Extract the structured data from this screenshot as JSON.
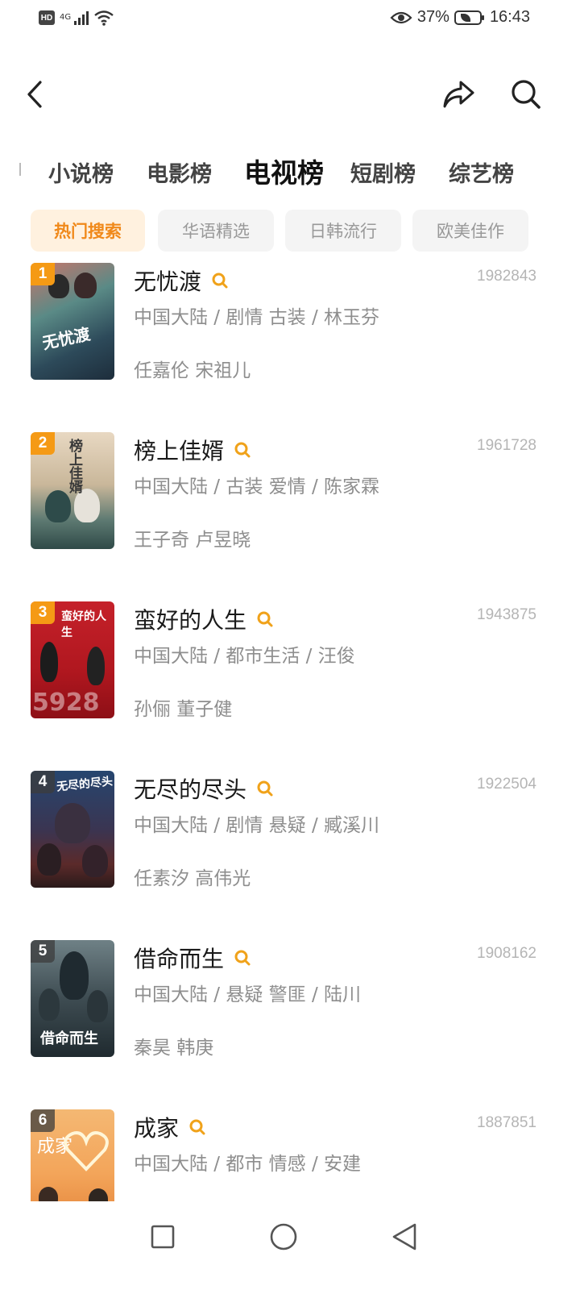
{
  "status_bar": {
    "hd_label": "HD",
    "network_label": "4G",
    "battery_percent": "37%",
    "time": "16:43",
    "icons": [
      "signal-icon",
      "wifi-icon",
      "eye-icon",
      "battery-icon"
    ]
  },
  "toolbar": {
    "back_icon": "chevron-left-icon",
    "share_icon": "share-icon",
    "search_icon": "search-icon"
  },
  "category_tabs": [
    {
      "label": "小说榜",
      "active": false
    },
    {
      "label": "电影榜",
      "active": false
    },
    {
      "label": "电视榜",
      "active": true
    },
    {
      "label": "短剧榜",
      "active": false
    },
    {
      "label": "综艺榜",
      "active": false
    }
  ],
  "sub_tabs": [
    {
      "label": "热门搜索",
      "active": true
    },
    {
      "label": "华语精选",
      "active": false
    },
    {
      "label": "日韩流行",
      "active": false
    },
    {
      "label": "欧美佳作",
      "active": false
    }
  ],
  "items": [
    {
      "rank": "1",
      "title": "无忧渡",
      "count": "1982843",
      "meta": "中国大陆 / 剧情 古装 / 林玉芬",
      "cast": "任嘉伦 宋祖儿",
      "poster_text": "无忧渡"
    },
    {
      "rank": "2",
      "title": "榜上佳婿",
      "count": "1961728",
      "meta": "中国大陆 / 古装 爱情 / 陈家霖",
      "cast": "王子奇 卢昱晓",
      "poster_text": "榜上佳婿"
    },
    {
      "rank": "3",
      "title": "蛮好的人生",
      "count": "1943875",
      "meta": "中国大陆 / 都市生活 / 汪俊",
      "cast": "孙俪 董子健",
      "poster_text": "蛮好的人生"
    },
    {
      "rank": "4",
      "title": "无尽的尽头",
      "count": "1922504",
      "meta": "中国大陆 / 剧情 悬疑 / 臧溪川",
      "cast": "任素汐 高伟光",
      "poster_text": "无尽的尽头"
    },
    {
      "rank": "5",
      "title": "借命而生",
      "count": "1908162",
      "meta": "中国大陆 / 悬疑 警匪 / 陆川",
      "cast": "秦昊 韩庚",
      "poster_text": "借命而生"
    },
    {
      "rank": "6",
      "title": "成家",
      "count": "1887851",
      "meta": "中国大陆 / 都市 情感 / 安建",
      "cast": "",
      "poster_text": "成家"
    }
  ],
  "colors": {
    "accent": "#f59a15",
    "chip_active_bg": "#fff1df",
    "chip_active_text": "#f0891a"
  },
  "nav_bar": {
    "icons": [
      "recents-square-icon",
      "home-circle-icon",
      "back-triangle-icon"
    ]
  }
}
